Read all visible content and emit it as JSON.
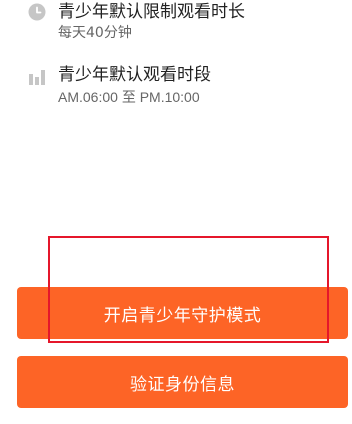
{
  "settings": {
    "time_limit": {
      "icon": "clock-icon",
      "title": "青少年默认限制观看时长",
      "subtitle": "每天40分钟"
    },
    "watch_period": {
      "icon": "bar-chart-icon",
      "title": "青少年默认观看时段",
      "subtitle": "AM.06:00 至 PM.10:00"
    }
  },
  "actions": {
    "enable_guard_label": "开启青少年守护模式",
    "verify_identity_label": "验证身份信息"
  },
  "colors": {
    "primary_button": "#fd6426",
    "icon_gray": "#c6c6c6",
    "highlight_border": "#e5172b"
  }
}
